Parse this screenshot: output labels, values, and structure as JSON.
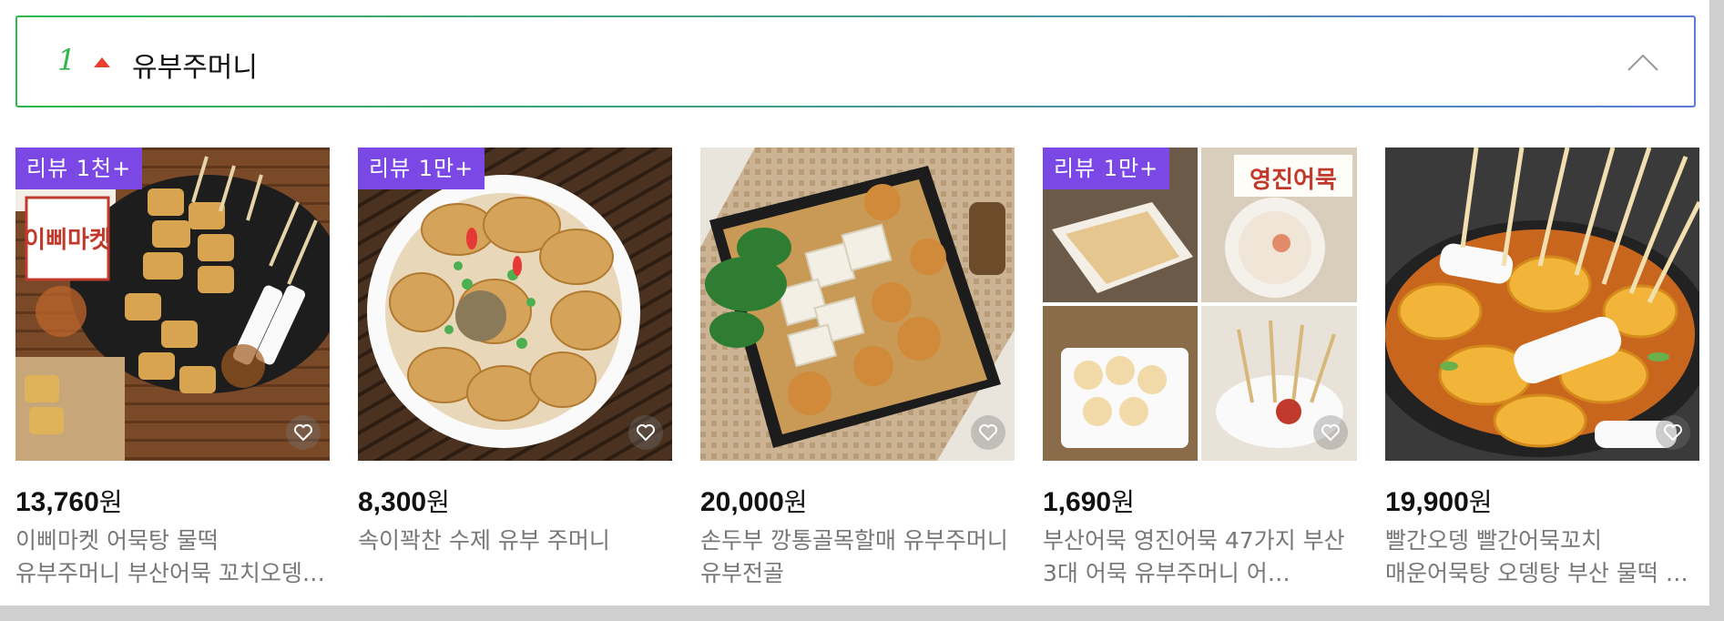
{
  "header": {
    "rank": "1",
    "keyword": "유부주머니"
  },
  "products": [
    {
      "badge": "리뷰 1천+",
      "price": "13,760",
      "currency": "원",
      "title": "이삐마켓 어묵탕 물떡 유부주머니 부산어묵 꼬치오뎅 오…",
      "logo_text": "이삐마켓"
    },
    {
      "badge": "리뷰 1만+",
      "price": "8,300",
      "currency": "원",
      "title": "속이꽉찬 수제 유부 주머니"
    },
    {
      "badge": "",
      "price": "20,000",
      "currency": "원",
      "title": "손두부 깡통골목할매 유부주머니 유부전골"
    },
    {
      "badge": "리뷰 1만+",
      "price": "1,690",
      "currency": "원",
      "title": "부산어묵 영진어묵 47가지 부산 3대 어묵 유부주머니 어…",
      "logo_text": "영진어묵"
    },
    {
      "badge": "",
      "price": "19,900",
      "currency": "원",
      "title": "빨간오뎅 빨간어묵꼬치 매운어묵탕 오뎅탕 부산 물떡 …"
    }
  ],
  "colors": {
    "badge": "#7b48e6",
    "rank": "#2db84b",
    "up_arrow": "#e8402e"
  }
}
